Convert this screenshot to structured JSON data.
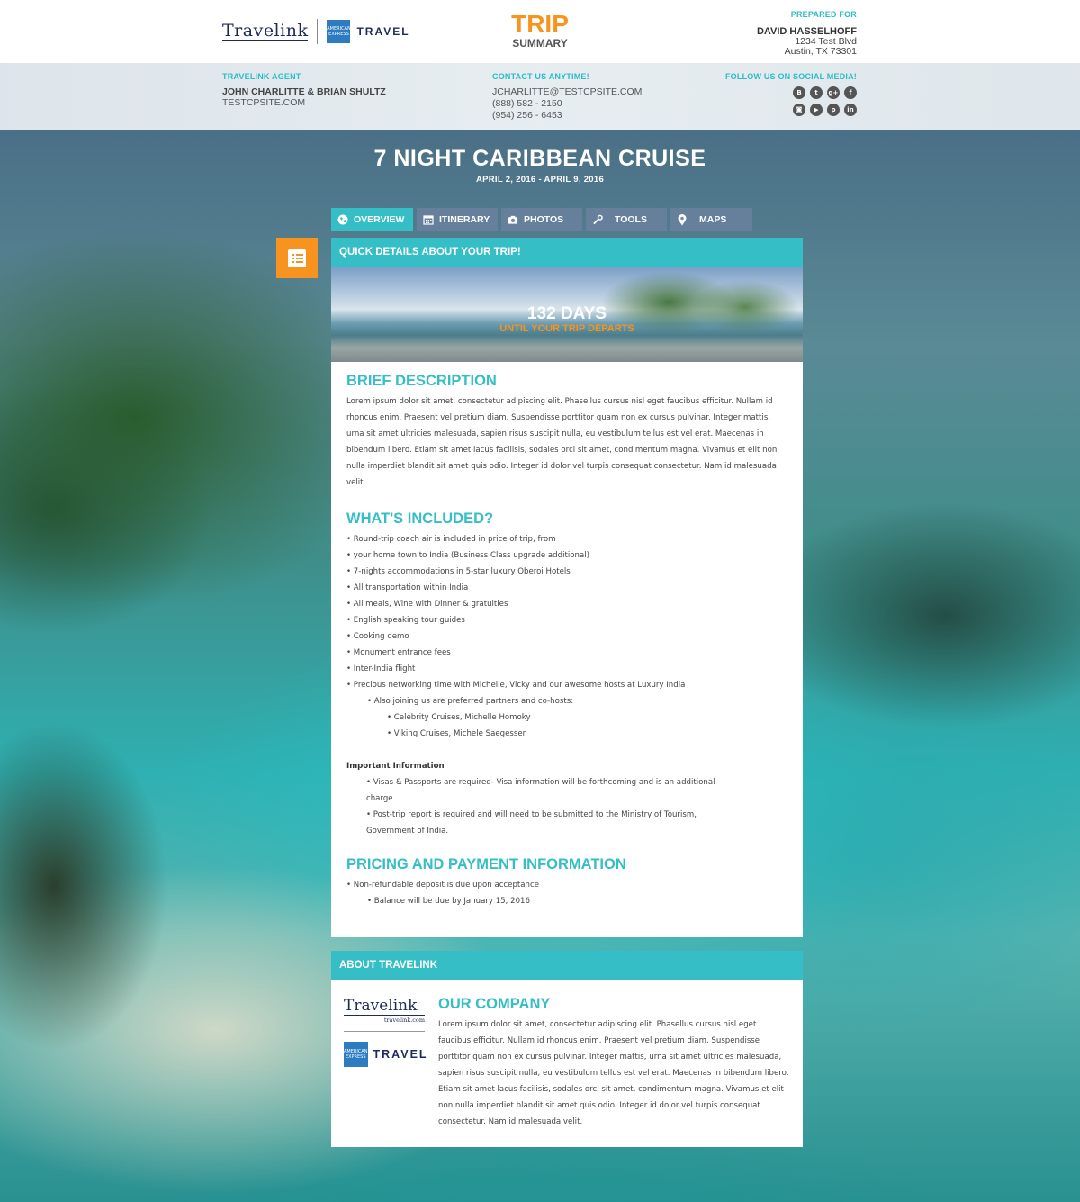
{
  "brand": {
    "name": "Travelink",
    "amex_label": "AMERICAN EXPRESS",
    "travel_label": "TRAVEL",
    "trip_word": "TRIP",
    "summary_word": "SUMMARY"
  },
  "prepared_for": {
    "label": "PREPARED FOR",
    "name": "DAVID HASSELHOFF",
    "address1": "1234 Test Blvd",
    "address2": "Austin, TX 73301"
  },
  "agent": {
    "label": "TRAVELINK AGENT",
    "names": "JOHN CHARLITTE & BRIAN SHULTZ",
    "site": "TESTCPSITE.COM"
  },
  "contact": {
    "label": "CONTACT US ANYTIME!",
    "email": "JCHARLITTE@TESTCPSITE.COM",
    "phone1": "(888) 582 - 2150",
    "phone2": "(954) 256 - 6453"
  },
  "social": {
    "label": "FOLLOW US ON SOCIAL MEDIA!",
    "icons": [
      "blogger-icon",
      "twitter-icon",
      "google-plus-icon",
      "facebook-icon",
      "instagram-icon",
      "youtube-icon",
      "pinterest-icon",
      "linkedin-icon"
    ]
  },
  "hero": {
    "title": "7 NIGHT CARIBBEAN CRUISE",
    "dates": "APRIL 2, 2016 - APRIL 9, 2016"
  },
  "tabs": [
    {
      "label": "OVERVIEW",
      "icon": "globe-icon"
    },
    {
      "label": "ITINERARY",
      "icon": "calendar-icon"
    },
    {
      "label": "PHOTOS",
      "icon": "camera-icon"
    },
    {
      "label": "TOOLS",
      "icon": "wrench-icon"
    },
    {
      "label": "MAPS",
      "icon": "map-pin-icon"
    }
  ],
  "quick": {
    "header": "QUICK DETAILS ABOUT YOUR TRIP!",
    "days": "132 DAYS",
    "until": "UNTIL YOUR TRIP DEPARTS"
  },
  "brief": {
    "title": "BRIEF DESCRIPTION",
    "text": "Lorem ipsum dolor sit amet, consectetur adipiscing elit. Phasellus cursus nisl eget faucibus efficitur. Nullam id rhoncus enim. Praesent vel pretium diam. Suspendisse porttitor quam non ex cursus pulvinar. Integer mattis, urna sit amet ultricies malesuada, sapien risus suscipit nulla, eu vestibulum tellus est vel erat. Maecenas in bibendum libero. Etiam sit amet lacus facilisis, sodales orci sit amet, condimentum magna. Vivamus et elit non nulla imperdiet blandit sit amet quis odio. Integer id dolor vel turpis consequat consectetur. Nam id malesuada velit."
  },
  "included": {
    "title": "WHAT'S INCLUDED?",
    "items": [
      "• Round-trip coach air is included in price of trip, from",
      "• your home town to India (Business Class upgrade additional)",
      "• 7-nights accommodations in 5-star luxury Oberoi Hotels",
      "• All transportation within India",
      "• All meals, Wine with Dinner & gratuities",
      "• English speaking tour guides",
      "• Cooking demo",
      "• Monument entrance fees",
      "• Inter-India flight",
      "• Precious networking time with Michelle, Vicky and our awesome hosts at Luxury India",
      "• Also joining us are preferred partners and co-hosts:",
      "• Celebrity Cruises, Michelle Homoky",
      "• Viking Cruises, Michele Saegesser"
    ],
    "important_title": "Important Information",
    "important": [
      "• Visas & Passports are required- Visa information will be forthcoming and is an additional charge",
      "• Post-trip report is required and will need to be submitted to the Ministry of Tourism, Government of India."
    ]
  },
  "pricing": {
    "title": "PRICING AND PAYMENT INFORMATION",
    "items": [
      "• Non-refundable deposit is due upon acceptance",
      "• Balance will be due by January 15, 2016"
    ]
  },
  "about": {
    "header": "ABOUT TRAVELINK",
    "logo_name": "Travelink",
    "logo_sub": "travelink.com",
    "travel_label": "TRAVEL",
    "amex_label": "AMERICAN EXPRESS",
    "title": "OUR COMPANY",
    "text": "Lorem ipsum dolor sit amet, consectetur adipiscing elit. Phasellus cursus nisl eget faucibus efficitur. Nullam id rhoncus enim. Praesent vel pretium diam. Suspendisse porttitor quam non ex cursus pulvinar. Integer mattis, urna sit amet ultricies malesuada, sapien risus suscipit nulla, eu vestibulum tellus est vel erat. Maecenas in bibendum libero. Etiam sit amet lacus facilisis, sodales orci sit amet, condimentum magna. Vivamus et elit non nulla imperdiet blandit sit amet quis odio. Integer id dolor vel turpis consequat consectetur. Nam id malesuada velit."
  },
  "colors": {
    "accent_teal": "#35bec6",
    "accent_orange": "#f7931e",
    "brand_navy": "#1d2a5c"
  }
}
